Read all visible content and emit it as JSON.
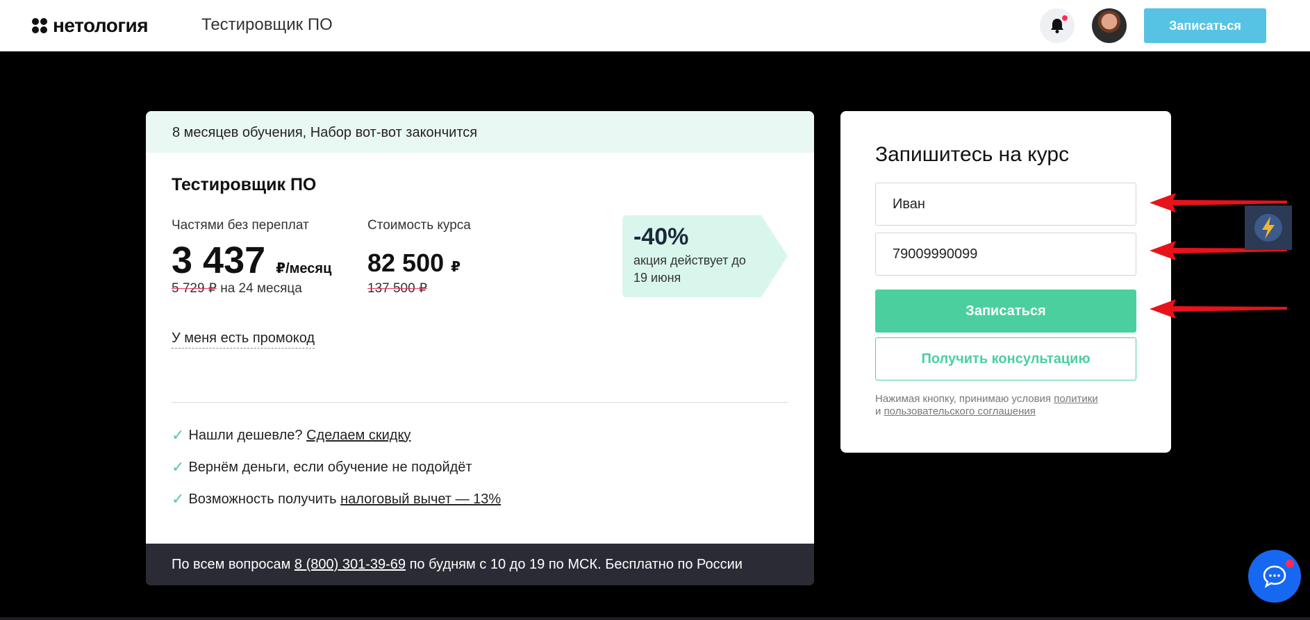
{
  "header": {
    "logo_text": "нетология",
    "course_name": "Тестировщик ПО",
    "cta_label": "Записаться"
  },
  "offer": {
    "banner": "8 месяцев обучения, Набор вот-вот закончится",
    "title": "Тестировщик ПО",
    "installment": {
      "label": "Частями без переплат",
      "price": "3 437",
      "unit": "₽/месяц",
      "old_price": "5 729 ₽",
      "term": "на 24 месяца"
    },
    "full": {
      "label": "Стоимость курса",
      "price": "82 500",
      "unit": "₽",
      "old_price": "137 500 ₽"
    },
    "discount": {
      "percent": "-40%",
      "text": "акция действует до 19 июня"
    },
    "promo_link": "У меня есть промокод",
    "benefits": [
      {
        "text": "Нашли дешевле?",
        "link": "Сделаем скидку"
      },
      {
        "text": "Вернём деньги, если обучение не подойдёт",
        "link": ""
      },
      {
        "text": "Возможность получить",
        "link": "налоговый вычет — 13%"
      }
    ],
    "footer": {
      "prefix": "По всем вопросам",
      "phone": "8 (800) 301-39-69",
      "suffix": "по будням с 10 до 19 по МСК. Бесплатно по России"
    }
  },
  "form": {
    "title": "Запишитесь на курс",
    "name_value": "Иван",
    "phone_value": "79009990099",
    "submit_label": "Записаться",
    "consult_label": "Получить консультацию",
    "legal_prefix": "Нажимая кнопку, принимаю условия",
    "legal_policy": "политики",
    "legal_and": "и",
    "legal_agreement": "пользовательского соглашения"
  },
  "colors": {
    "accent_green": "#4bcf9f",
    "header_cta": "#56c3e4",
    "arrow_red": "#e8121b",
    "chat_blue": "#1668f2"
  }
}
